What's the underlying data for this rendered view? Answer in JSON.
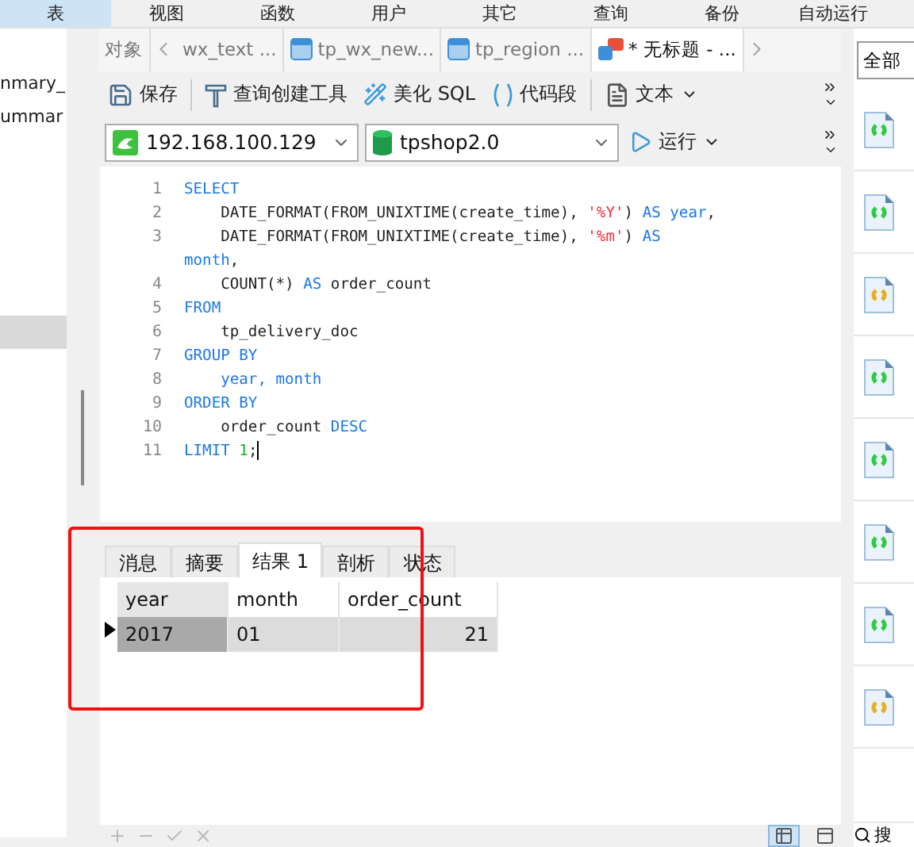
{
  "menu": [
    {
      "label": "表",
      "selected": true
    },
    {
      "label": "视图",
      "selected": false
    },
    {
      "label": "函数",
      "selected": false
    },
    {
      "label": "用户",
      "selected": false
    },
    {
      "label": "其它",
      "selected": false
    },
    {
      "label": "查询",
      "selected": false
    },
    {
      "label": "备份",
      "selected": false
    },
    {
      "label": "自动运行",
      "selected": false
    }
  ],
  "sidebar": {
    "items": [
      {
        "label": "nmary_"
      },
      {
        "label": "ummar"
      }
    ]
  },
  "editor_tabs": [
    {
      "label": "对象",
      "kind": "plain",
      "selected": false
    },
    {
      "label": "wx_text ...",
      "kind": "back",
      "selected": false
    },
    {
      "label": "tp_wx_new...",
      "kind": "table",
      "selected": false
    },
    {
      "label": "tp_region ...",
      "kind": "table",
      "selected": false
    },
    {
      "label": "* 无标题 - ...",
      "kind": "query",
      "selected": true
    }
  ],
  "toolbar": [
    {
      "label": "保存",
      "kind": "save"
    },
    {
      "label": "查询创建工具",
      "kind": "builder"
    },
    {
      "label": "美化 SQL",
      "kind": "beautify"
    },
    {
      "label": "代码段",
      "kind": "snippet"
    },
    {
      "label": "文本",
      "kind": "text"
    }
  ],
  "connection": {
    "server": "192.168.100.129",
    "database": "tpshop2.0",
    "run": "运行"
  },
  "code": [
    {
      "number": "1",
      "tokens": [
        {
          "kind": "kw",
          "text": "SELECT"
        }
      ]
    },
    {
      "number": "2",
      "tokens": [
        {
          "kind": "plain",
          "text": "    DATE_FORMAT(FROM_UNIXTIME(create_time), "
        },
        {
          "kind": "str",
          "text": "'%Y'"
        },
        {
          "kind": "plain",
          "text": ") "
        },
        {
          "kind": "kw",
          "text": "AS year"
        },
        {
          "kind": "plain",
          "text": ","
        }
      ]
    },
    {
      "number": "3",
      "tokens": [
        {
          "kind": "plain",
          "text": "    DATE_FORMAT(FROM_UNIXTIME(create_time), "
        },
        {
          "kind": "str",
          "text": "'%m'"
        },
        {
          "kind": "plain",
          "text": ") "
        },
        {
          "kind": "kw",
          "text": "AS"
        }
      ]
    },
    {
      "tokens": [
        {
          "kind": "kw",
          "text": "month"
        },
        {
          "kind": "plain",
          "text": ","
        }
      ]
    },
    {
      "number": "4",
      "tokens": [
        {
          "kind": "plain",
          "text": "    COUNT(*) "
        },
        {
          "kind": "kw",
          "text": "AS"
        },
        {
          "kind": "plain",
          "text": " order_count"
        }
      ]
    },
    {
      "number": "5",
      "tokens": [
        {
          "kind": "kw",
          "text": "FROM"
        }
      ]
    },
    {
      "number": "6",
      "tokens": [
        {
          "kind": "plain",
          "text": "    tp_delivery_doc"
        }
      ]
    },
    {
      "number": "7",
      "tokens": [
        {
          "kind": "kw",
          "text": "GROUP BY"
        }
      ]
    },
    {
      "number": "8",
      "tokens": [
        {
          "kind": "kw",
          "text": "    year, month"
        }
      ]
    },
    {
      "number": "9",
      "tokens": [
        {
          "kind": "kw",
          "text": "ORDER BY"
        }
      ]
    },
    {
      "number": "10",
      "tokens": [
        {
          "kind": "plain",
          "text": "    order_count "
        },
        {
          "kind": "kw",
          "text": "DESC"
        }
      ]
    },
    {
      "number": "11",
      "tokens": [
        {
          "kind": "kw",
          "text": "LIMIT "
        },
        {
          "kind": "num",
          "text": "1"
        },
        {
          "kind": "plain",
          "text": ";"
        }
      ]
    }
  ],
  "result_tabs": [
    {
      "label": "消息",
      "selected": false
    },
    {
      "label": "摘要",
      "selected": false
    },
    {
      "label": "结果 1",
      "selected": true
    },
    {
      "label": "剖析",
      "selected": false
    },
    {
      "label": "状态",
      "selected": false
    }
  ],
  "table": {
    "columns": [
      "year",
      "month",
      "order_count"
    ],
    "rows": [
      {
        "cells": [
          "2017",
          "01",
          "21"
        ],
        "selected": true
      }
    ]
  },
  "snippets_filter": "全部",
  "snippets": [
    {
      "color": "#2ecc40"
    },
    {
      "color": "#2ecc40"
    },
    {
      "color": "#e8b020"
    },
    {
      "color": "#2ecc40"
    },
    {
      "color": "#2ecc40"
    },
    {
      "color": "#2ecc40"
    },
    {
      "color": "#2ecc40"
    },
    {
      "color": "#e8b020"
    }
  ],
  "search_label": "搜"
}
